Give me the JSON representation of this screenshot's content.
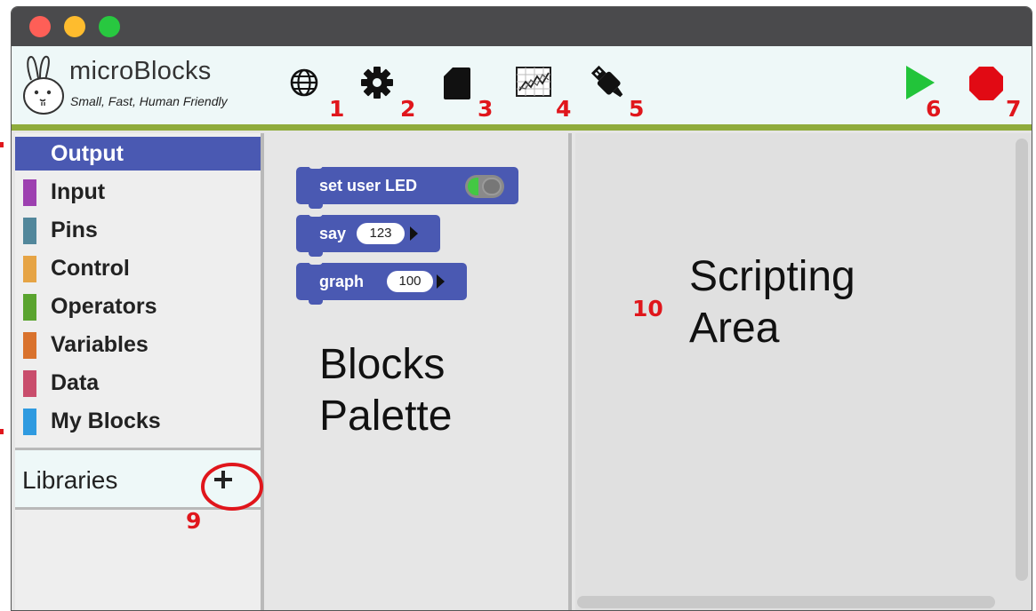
{
  "app": {
    "name": "microBlocks",
    "tagline": "Small, Fast, Human Friendly"
  },
  "toolbar": {
    "buttons": [
      {
        "icon": "globe-icon",
        "badge": "1"
      },
      {
        "icon": "gear-icon",
        "badge": "2"
      },
      {
        "icon": "file-icon",
        "badge": "3"
      },
      {
        "icon": "graph-icon",
        "badge": "4"
      },
      {
        "icon": "usb-icon",
        "badge": "5"
      },
      {
        "icon": "start-icon",
        "badge": "6"
      },
      {
        "icon": "stop-icon",
        "badge": "7"
      }
    ]
  },
  "categories": [
    {
      "label": "Output",
      "color": "#4a59b2",
      "selected": true
    },
    {
      "label": "Input",
      "color": "#9d40b0"
    },
    {
      "label": "Pins",
      "color": "#52879b"
    },
    {
      "label": "Control",
      "color": "#e6a445"
    },
    {
      "label": "Operators",
      "color": "#5aa42f"
    },
    {
      "label": "Variables",
      "color": "#d9722d"
    },
    {
      "label": "Data",
      "color": "#c94d6c"
    },
    {
      "label": "My Blocks",
      "color": "#2f9ae0"
    }
  ],
  "libraries": {
    "label": "Libraries",
    "add_symbol": "+",
    "badge": "9"
  },
  "palette": {
    "blocks": [
      {
        "text": "set user LED"
      },
      {
        "text": "say",
        "slot": "123"
      },
      {
        "text": "graph",
        "slot": "100"
      }
    ],
    "annotation_line1": "Blocks",
    "annotation_line2": "Palette"
  },
  "scripting": {
    "badge": "10",
    "annotation_line1": "Scripting",
    "annotation_line2": "Area"
  },
  "colors": {
    "accent": "#4a59b2",
    "badge": "#e0161c",
    "toolbar_rule": "#8fac3c",
    "start": "#22c43a",
    "stop": "#e10a14"
  }
}
